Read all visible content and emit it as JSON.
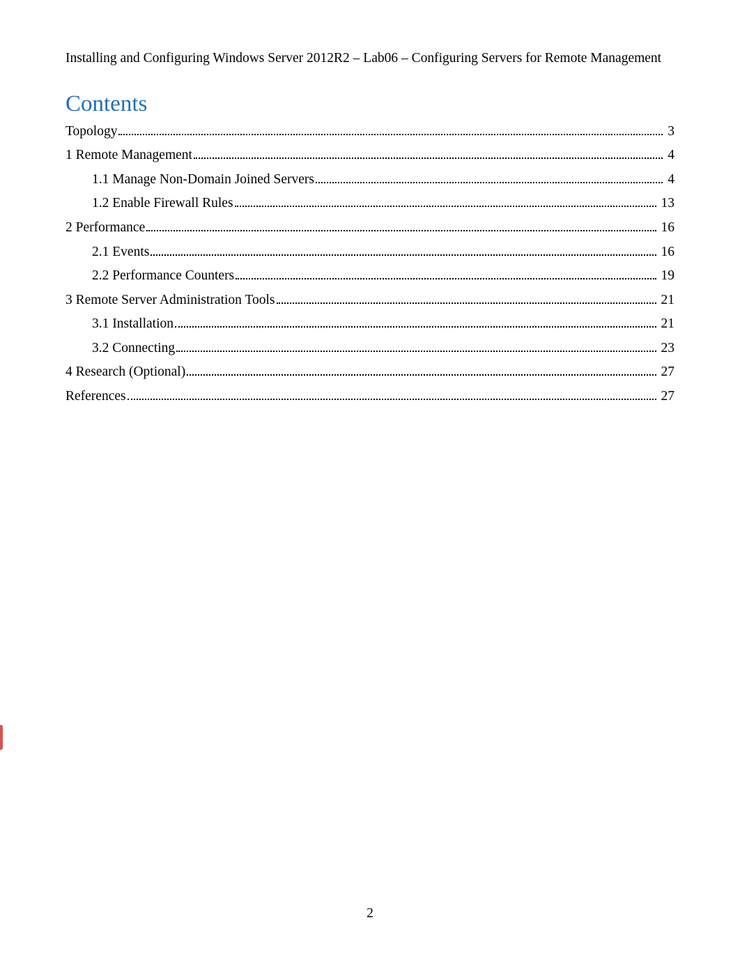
{
  "header": {
    "text": "Installing and Configuring Windows Server 2012R2 – Lab06 – Configuring Servers for Remote Management"
  },
  "contents": {
    "heading": "Contents",
    "entries": [
      {
        "level": 1,
        "title": "Topology",
        "page": "3"
      },
      {
        "level": 1,
        "title": "1 Remote Management ",
        "page": "4"
      },
      {
        "level": 2,
        "title": "1.1 Manage Non-Domain Joined Servers",
        "page": "4"
      },
      {
        "level": 2,
        "title": "1.2 Enable Firewall Rules",
        "page": "13"
      },
      {
        "level": 1,
        "title": "2 Performance",
        "page": " 16"
      },
      {
        "level": 2,
        "title": "2.1 Events",
        "page": "16"
      },
      {
        "level": 2,
        "title": "2.2 Performance Counters ",
        "page": " 19"
      },
      {
        "level": 1,
        "title": "3 Remote Server Administration Tools",
        "page": "21"
      },
      {
        "level": 2,
        "title": "3.1 Installation",
        "page": " 21"
      },
      {
        "level": 2,
        "title": "3.2 Connecting",
        "page": " 23"
      },
      {
        "level": 1,
        "title": "4 Research (Optional)",
        "page": "27"
      },
      {
        "level": 1,
        "title": "References",
        "page": " 27"
      }
    ]
  },
  "footer": {
    "page_number": "2"
  }
}
